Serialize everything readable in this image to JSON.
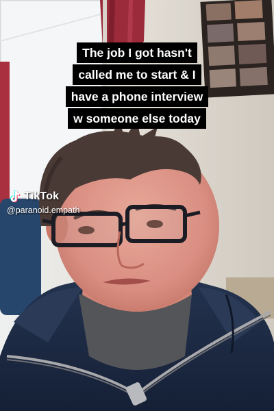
{
  "caption": {
    "lines": [
      "The job I got hasn't",
      "called me to start & I",
      "have a phone interview",
      "w someone else today"
    ]
  },
  "watermark": {
    "brand": "TikTok",
    "handle": "@paranoid.empath",
    "icon": "tiktok-logo-icon"
  },
  "colors": {
    "caption_bg": "#000000",
    "caption_text": "#ffffff",
    "curtain": "#9b2a3a",
    "hoodie": "#1d2b45",
    "wall": "#dcd7cf"
  }
}
